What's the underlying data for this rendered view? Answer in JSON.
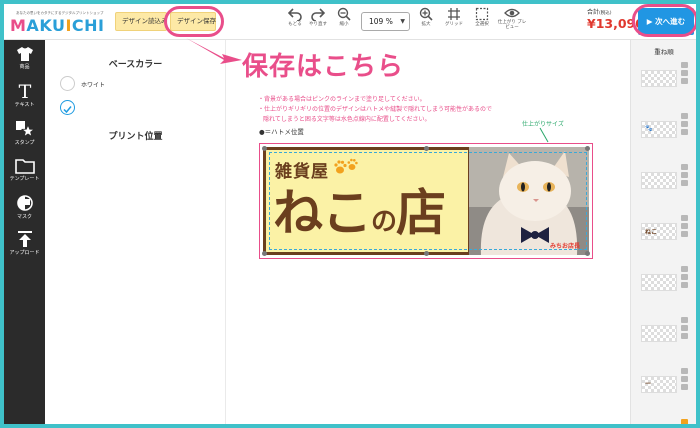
{
  "header": {
    "logo_tagline": "あなたの思いをカタチにするデジタルプリントショップ",
    "logo_letters": [
      "M",
      "A",
      "K",
      "U",
      "I",
      "C",
      "H",
      "I"
    ],
    "design_load_label": "デザイン読込み",
    "design_save_label": "デザイン保存",
    "tools": [
      {
        "id": "undo",
        "label": "もどる"
      },
      {
        "id": "redo",
        "label": "やり直す"
      },
      {
        "id": "zoom-out",
        "label": "縮小"
      },
      {
        "id": "zoom-in",
        "label": "拡大"
      },
      {
        "id": "grid",
        "label": "グリッド"
      },
      {
        "id": "select-all",
        "label": "全選択"
      },
      {
        "id": "preview",
        "label": "仕上がり プレビュー"
      }
    ],
    "zoom_value": "109 %",
    "total_label": "合計",
    "total_tax_note": "(税込)",
    "total_price": "¥13,090",
    "next_label": "▶ 次へ進む"
  },
  "leftbar": {
    "items": [
      {
        "id": "product",
        "label": "商品",
        "icon": "tshirt-icon"
      },
      {
        "id": "text",
        "label": "テキスト",
        "icon": "text-icon"
      },
      {
        "id": "stamp",
        "label": "スタンプ",
        "icon": "stamp-icon"
      },
      {
        "id": "template",
        "label": "テンプレート",
        "icon": "folder-icon"
      },
      {
        "id": "mask",
        "label": "マスク",
        "icon": "mask-icon"
      },
      {
        "id": "upload",
        "label": "アップロード",
        "icon": "upload-icon"
      }
    ]
  },
  "options": {
    "base_color_title": "ベースカラー",
    "white_label": "ホワイト",
    "print_position_title": "プリント位置"
  },
  "canvas": {
    "callout": "保存はこちら",
    "notices": [
      "・背景がある場合はピンクのラインまで塗り足してください。",
      "・仕上がりギリギリの位置のデザインはハトメや縫製で隠れてしまう可能性があるので",
      "隠れてしまうと困る文字等は水色点線内に配置してください。"
    ],
    "hatome_legend": "●＝ハトメ位置",
    "finish_size_label": "仕上がりサイズ",
    "banner_shop": "雑貨屋",
    "banner_name_main": "ねこ",
    "banner_name_particle": "の",
    "banner_name_end": "店",
    "photo_caption": "みちお店長"
  },
  "layers": {
    "title": "重ね順",
    "items": [
      {
        "thumb": ""
      },
      {
        "thumb": "🐾"
      },
      {
        "thumb": ""
      },
      {
        "thumb": "ねこ"
      },
      {
        "thumb": ""
      },
      {
        "thumb": ""
      },
      {
        "thumb": "—"
      },
      {
        "thumb": ""
      }
    ]
  },
  "colors": {
    "accent_pink": "#e94e8a",
    "primary_blue": "#2196e3",
    "price_red": "#e0382e",
    "banner_brown": "#6b3f1e",
    "banner_yellow": "#fbf2a6",
    "page_frame_teal": "#3fc1c9"
  }
}
